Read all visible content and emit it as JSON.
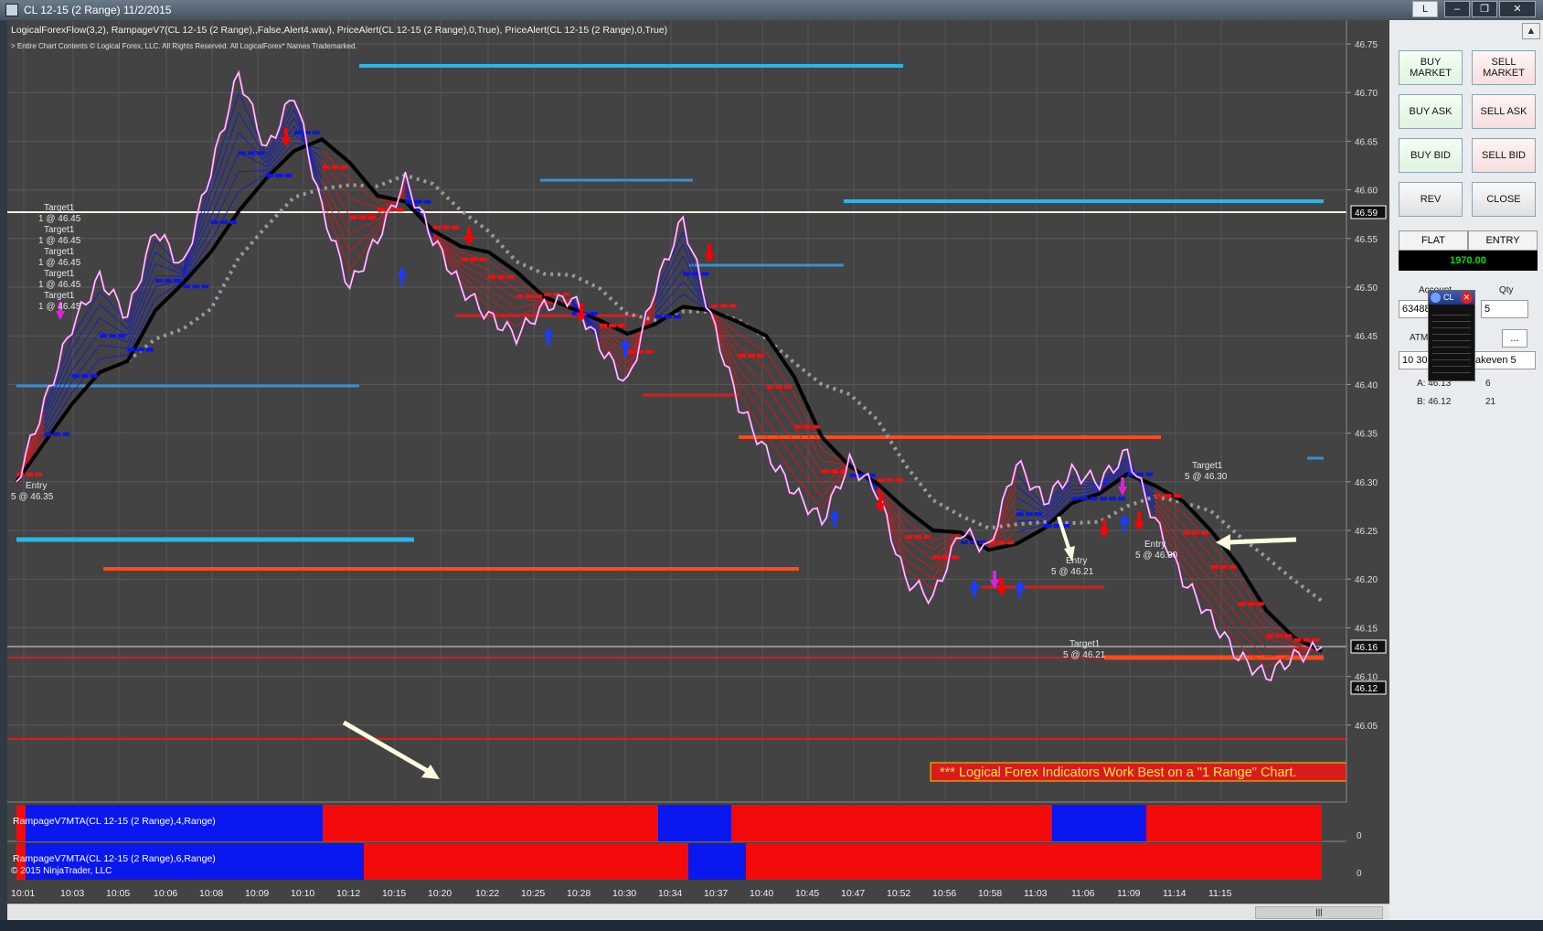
{
  "window": {
    "title": "CL 12-15 (2 Range)  11/2/2015",
    "btn_l": "L",
    "btn_min": "–",
    "btn_restore": "❐",
    "btn_close": "✕"
  },
  "chart": {
    "indicator_line": "LogicalForexFlow(3,2),  RampageV7(CL 12-15 (2 Range),,False,Alert4.wav), PriceAlert(CL 12-15 (2 Range),0,True), PriceAlert(CL 12-15 (2 Range),0,True)",
    "copyright_line": "> Entire Chart Contents © Logical Forex, LLC. All Rights Reserved. All LogicalForex* Names Trademarked.",
    "banner": "*** Logical Forex Indicators Work Best on a \"1 Range\" Chart.",
    "panel1_label": "RampageV7MTA(CL 12-15 (2 Range),4,Range)",
    "panel2_label": "RampageV7MTA(CL 12-15 (2 Range),6,Range)",
    "ninja_copyright": "© 2015 NinjaTrader, LLC",
    "panel_zero_1": "0",
    "panel_zero_2": "0",
    "price_marker_1": "46.59",
    "price_marker_2": "46.16",
    "price_marker_3": "46.12",
    "annotations": {
      "entry_left": "Entry",
      "entry_left_detail": "5 @ 46.35",
      "target_stack_label": "Target1",
      "target_stack_detail": "1 @ 46.45",
      "entry_mid": "Entry",
      "entry_mid_detail": "5 @ 46.21",
      "target_mid": "Target1",
      "target_mid_detail": "5 @ 46.21",
      "entry_right": "Entry",
      "entry_right_detail": "5 @ 46.30",
      "target_right": "Target1",
      "target_right_detail": "5 @ 46.30"
    }
  },
  "chart_data": {
    "type": "line",
    "y_ticks": [
      "46.75",
      "46.70",
      "46.65",
      "46.60",
      "46.55",
      "46.50",
      "46.45",
      "46.40",
      "46.35",
      "46.30",
      "46.25",
      "46.20",
      "46.15",
      "46.10",
      "46.05"
    ],
    "x_ticks": [
      "10:01",
      "10:03",
      "10:05",
      "10:06",
      "10:08",
      "10:09",
      "10:10",
      "10:12",
      "10:15",
      "10:20",
      "10:22",
      "10:25",
      "10:28",
      "10:30",
      "10:34",
      "10:37",
      "10:40",
      "10:45",
      "10:47",
      "10:52",
      "10:56",
      "10:58",
      "11:03",
      "11:06",
      "11:09",
      "11:14",
      "11:15"
    ],
    "ylim": [
      46.02,
      46.77
    ],
    "price_series": [
      46.3,
      46.38,
      46.46,
      46.51,
      46.47,
      46.56,
      46.52,
      46.62,
      46.72,
      46.64,
      46.7,
      46.58,
      46.5,
      46.55,
      46.61,
      46.55,
      46.5,
      46.47,
      46.45,
      46.48,
      46.49,
      46.44,
      46.4,
      46.5,
      46.57,
      46.47,
      46.38,
      46.33,
      46.29,
      46.26,
      46.32,
      46.29,
      46.2,
      46.18,
      46.25,
      46.23,
      46.32,
      46.28,
      46.31,
      46.3,
      46.33,
      46.26,
      46.2,
      46.16,
      46.12,
      46.1,
      46.12,
      46.13
    ]
  },
  "order_panel": {
    "buy_market": "BUY MARKET",
    "sell_market": "SELL MARKET",
    "buy_ask": "BUY ASK",
    "sell_ask": "SELL ASK",
    "buy_bid": "BUY BID",
    "sell_bid": "SELL BID",
    "rev": "REV",
    "close": "CLOSE",
    "position": "FLAT",
    "entry": "ENTRY",
    "pnl": "1970.00",
    "account_label": "Account",
    "qty_label": "Qty",
    "account_value": "63488",
    "qty_value": "5",
    "atm_label": "ATM",
    "atm_value": "10 30",
    "atm_strategy": "akeven 5",
    "more_button": "...",
    "ask_label": "A: 46.13",
    "ask_size": "6",
    "bid_label": "B: 46.12",
    "bid_size": "21",
    "popup_title": "CL",
    "collapse_button": "▲"
  },
  "colors": {
    "chart_bg": "#434343",
    "bull": "#0b16e8",
    "bear": "#f20f0f",
    "price": "#ff70ff",
    "pnl_text": "#00e300"
  }
}
